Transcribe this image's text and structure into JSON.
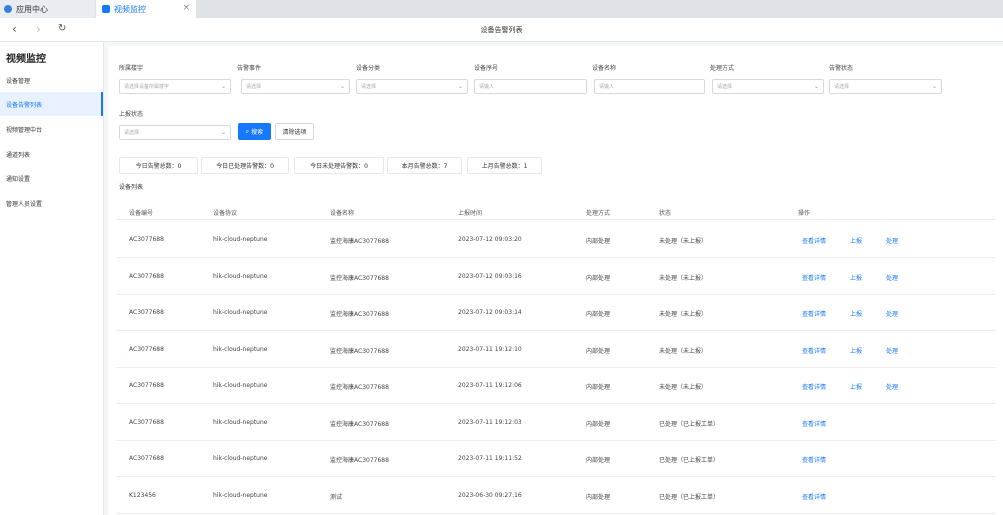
{
  "tabs": [
    {
      "label": "应用中心"
    },
    {
      "label": "视频监控"
    }
  ],
  "page_title": "设备告警列表",
  "sidebar": {
    "title": "视频监控",
    "items": [
      "设备管理",
      "设备告警列表",
      "视频管理中台",
      "通道列表",
      "通知设置",
      "管理人员设置"
    ]
  },
  "filters": [
    {
      "label": "所属楼宇",
      "placeholder": "请选择设备所属楼宇"
    },
    {
      "label": "告警事件",
      "placeholder": "请选择"
    },
    {
      "label": "设备分类",
      "placeholder": "请选择"
    },
    {
      "label": "设备序号",
      "placeholder": "请输入"
    },
    {
      "label": "设备名称",
      "placeholder": "请输入"
    },
    {
      "label": "处理方式",
      "placeholder": "请选择"
    },
    {
      "label": "告警状态",
      "placeholder": "请选择"
    },
    {
      "label": "上报状态",
      "placeholder": "请选择"
    }
  ],
  "buttons": {
    "search": "搜索",
    "clear": "清除选项"
  },
  "stats": [
    "今日告警总数：0",
    "今日已处理告警数：0",
    "今日未处理告警数：0",
    "本月告警总数：7",
    "上月告警总数：1"
  ],
  "section_title": "设备列表",
  "columns": [
    "设备编号",
    "设备协议",
    "设备名称",
    "上报时间",
    "处理方式",
    "状态",
    "操作"
  ],
  "actions": {
    "detail": "查看详情",
    "report": "上报",
    "handle": "处理"
  },
  "rows": [
    {
      "id": "AC3077688",
      "protocol": "hik-cloud-neptune",
      "name": "监控海康AC3077688",
      "time": "2023-07-12 09:03:20",
      "method": "内部处理",
      "status": "未处理（未上报）",
      "ops": 3
    },
    {
      "id": "AC3077688",
      "protocol": "hik-cloud-neptune",
      "name": "监控海康AC3077688",
      "time": "2023-07-12 09:03:16",
      "method": "内部处理",
      "status": "未处理（未上报）",
      "ops": 3
    },
    {
      "id": "AC3077688",
      "protocol": "hik-cloud-neptune",
      "name": "监控海康AC3077688",
      "time": "2023-07-12 09:03:14",
      "method": "内部处理",
      "status": "未处理（未上报）",
      "ops": 3
    },
    {
      "id": "AC3077688",
      "protocol": "hik-cloud-neptune",
      "name": "监控海康AC3077688",
      "time": "2023-07-11 19:12:10",
      "method": "内部处理",
      "status": "未处理（未上报）",
      "ops": 3
    },
    {
      "id": "AC3077688",
      "protocol": "hik-cloud-neptune",
      "name": "监控海康AC3077688",
      "time": "2023-07-11 19:12:06",
      "method": "内部处理",
      "status": "未处理（未上报）",
      "ops": 3
    },
    {
      "id": "AC3077688",
      "protocol": "hik-cloud-neptune",
      "name": "监控海康AC3077688",
      "time": "2023-07-11 19:12:03",
      "method": "内部处理",
      "status": "已处理（已上报工单）",
      "ops": 1
    },
    {
      "id": "AC3077688",
      "protocol": "hik-cloud-neptune",
      "name": "监控海康AC3077688",
      "time": "2023-07-11 19:11:52",
      "method": "内部处理",
      "status": "已处理（已上报工单）",
      "ops": 1
    },
    {
      "id": "K123456",
      "protocol": "hik-cloud-neptune",
      "name": "测试",
      "time": "2023-06-30 09:27:16",
      "method": "内部处理",
      "status": "已处理（已上报工单）",
      "ops": 1
    }
  ],
  "colors": {
    "primary": "#1677ff",
    "sidebar_active_bg": "#e8f1ff"
  }
}
